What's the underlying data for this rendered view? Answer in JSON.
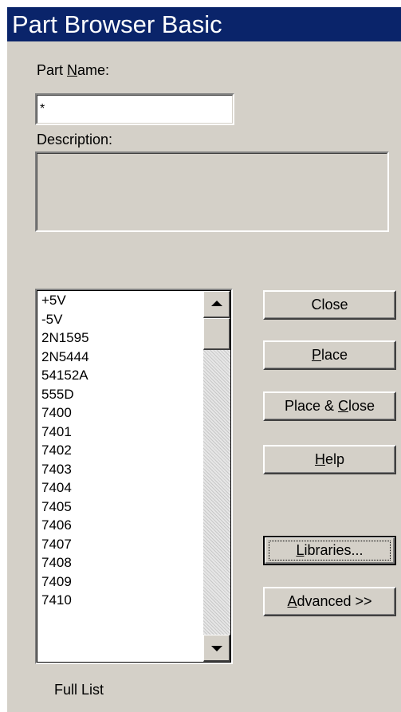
{
  "dialog": {
    "title": "Part Browser Basic",
    "part_name_label": "Part Name:",
    "part_name_value": "*",
    "description_label": "Description:",
    "description_value": "",
    "status_text": "Full List"
  },
  "parts_list": [
    "+5V",
    "-5V",
    "2N1595",
    "2N5444",
    "54152A",
    "555D",
    "7400",
    "7401",
    "7402",
    "7403",
    "7404",
    "7405",
    "7406",
    "7407",
    "7408",
    "7409",
    "7410"
  ],
  "buttons": {
    "close": "Close",
    "place": "Place",
    "place_close": "Place & Close",
    "help": "Help",
    "libraries": "Libraries...",
    "advanced": "Advanced >>"
  },
  "colors": {
    "title_bar": "#0a246a",
    "dialog_bg": "#d4d0c8"
  },
  "scrollbar": {
    "position_fraction": 0.0
  }
}
